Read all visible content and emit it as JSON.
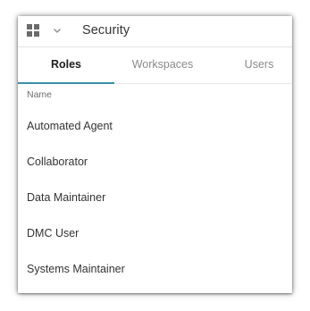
{
  "header": {
    "title": "Security",
    "apps_icon": "apps-grid-icon",
    "chevron_icon": "chevron-down-icon"
  },
  "tabs": [
    {
      "label": "Roles",
      "active": true
    },
    {
      "label": "Workspaces",
      "active": false
    },
    {
      "label": "Users",
      "active": false
    }
  ],
  "list": {
    "column_header": "Name",
    "items": [
      {
        "name": "Automated Agent"
      },
      {
        "name": "Collaborator"
      },
      {
        "name": "Data Maintainer"
      },
      {
        "name": "DMC User"
      },
      {
        "name": "Systems Maintainer"
      }
    ]
  },
  "colors": {
    "accent": "#3a8fa8",
    "text": "#333333",
    "muted_tab": "#8a8a8a",
    "icon": "#6b6b6b"
  }
}
